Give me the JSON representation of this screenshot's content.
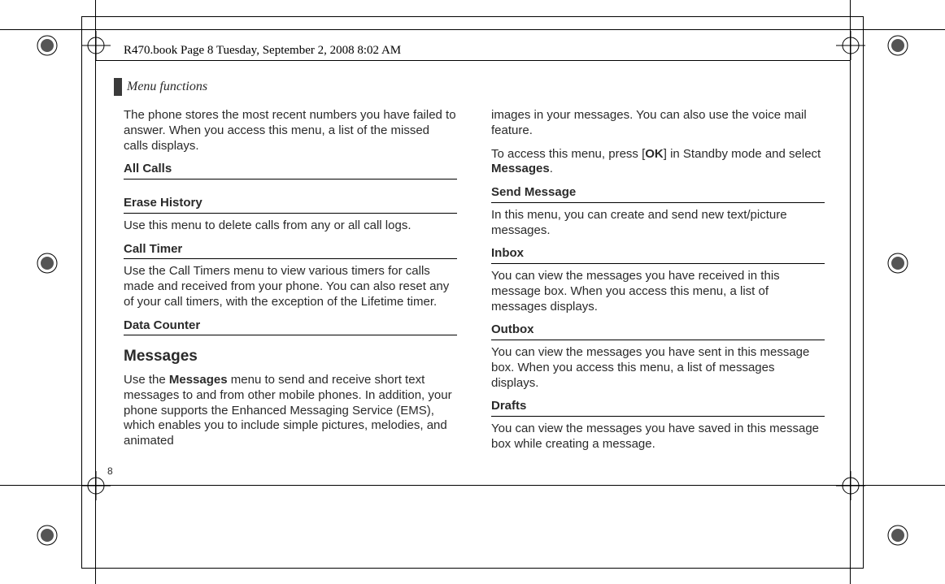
{
  "header": {
    "timestamp": "R470.book  Page 8  Tuesday, September 2, 2008  8:02 AM"
  },
  "section": {
    "title": "Menu functions"
  },
  "page_number": "8",
  "col1": {
    "intro_para": "The phone stores the most recent numbers you have failed to answer. When you access this menu, a list of the missed calls displays.",
    "all_calls": "All Calls",
    "erase_history": "Erase History",
    "erase_history_body": "Use this menu to delete calls from any or all call logs.",
    "call_timer": "Call Timer",
    "call_timer_body": "Use the Call Timers menu to view various timers for calls made and received from your phone. You can also reset any of your call timers, with the exception of the Lifetime timer.",
    "data_counter": "Data Counter",
    "messages": "Messages",
    "messages_body_1": "Use the ",
    "messages_body_bold": "Messages",
    "messages_body_2": " menu to send and receive short text messages to and from other mobile phones. In addition, your phone supports the Enhanced Messaging Service (EMS), which enables you to include simple pictures, melodies, and animated"
  },
  "col2": {
    "cont_para": "images in your messages. You can also use the voice mail feature.",
    "access_1": "To access this menu, press [",
    "access_bold_ok": "OK",
    "access_2": "] in Standby mode and select ",
    "access_bold_messages": "Messages",
    "access_3": ".",
    "send_message": "Send Message",
    "send_message_body": "In this menu, you can create and send new text/picture messages.",
    "inbox": "Inbox",
    "inbox_body": "You can view the messages you have received in this message box. When you access this menu, a list of messages displays.",
    "outbox": "Outbox",
    "outbox_body": "You can view the messages you have sent in this message box. When you access this menu, a list of messages displays.",
    "drafts": "Drafts",
    "drafts_body": "You can view the messages you have saved in this message box while creating a message."
  }
}
